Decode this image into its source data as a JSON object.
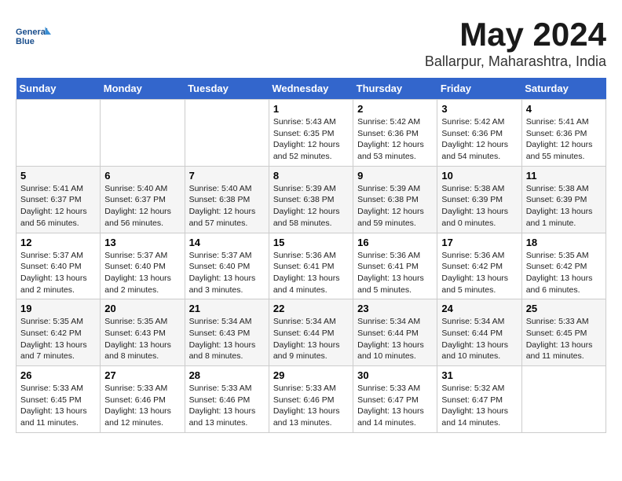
{
  "logo": {
    "line1": "General",
    "line2": "Blue"
  },
  "title": "May 2024",
  "subtitle": "Ballarpur, Maharashtra, India",
  "days_of_week": [
    "Sunday",
    "Monday",
    "Tuesday",
    "Wednesday",
    "Thursday",
    "Friday",
    "Saturday"
  ],
  "weeks": [
    [
      {
        "day": "",
        "info": ""
      },
      {
        "day": "",
        "info": ""
      },
      {
        "day": "",
        "info": ""
      },
      {
        "day": "1",
        "info": "Sunrise: 5:43 AM\nSunset: 6:35 PM\nDaylight: 12 hours\nand 52 minutes."
      },
      {
        "day": "2",
        "info": "Sunrise: 5:42 AM\nSunset: 6:36 PM\nDaylight: 12 hours\nand 53 minutes."
      },
      {
        "day": "3",
        "info": "Sunrise: 5:42 AM\nSunset: 6:36 PM\nDaylight: 12 hours\nand 54 minutes."
      },
      {
        "day": "4",
        "info": "Sunrise: 5:41 AM\nSunset: 6:36 PM\nDaylight: 12 hours\nand 55 minutes."
      }
    ],
    [
      {
        "day": "5",
        "info": "Sunrise: 5:41 AM\nSunset: 6:37 PM\nDaylight: 12 hours\nand 56 minutes."
      },
      {
        "day": "6",
        "info": "Sunrise: 5:40 AM\nSunset: 6:37 PM\nDaylight: 12 hours\nand 56 minutes."
      },
      {
        "day": "7",
        "info": "Sunrise: 5:40 AM\nSunset: 6:38 PM\nDaylight: 12 hours\nand 57 minutes."
      },
      {
        "day": "8",
        "info": "Sunrise: 5:39 AM\nSunset: 6:38 PM\nDaylight: 12 hours\nand 58 minutes."
      },
      {
        "day": "9",
        "info": "Sunrise: 5:39 AM\nSunset: 6:38 PM\nDaylight: 12 hours\nand 59 minutes."
      },
      {
        "day": "10",
        "info": "Sunrise: 5:38 AM\nSunset: 6:39 PM\nDaylight: 13 hours\nand 0 minutes."
      },
      {
        "day": "11",
        "info": "Sunrise: 5:38 AM\nSunset: 6:39 PM\nDaylight: 13 hours\nand 1 minute."
      }
    ],
    [
      {
        "day": "12",
        "info": "Sunrise: 5:37 AM\nSunset: 6:40 PM\nDaylight: 13 hours\nand 2 minutes."
      },
      {
        "day": "13",
        "info": "Sunrise: 5:37 AM\nSunset: 6:40 PM\nDaylight: 13 hours\nand 2 minutes."
      },
      {
        "day": "14",
        "info": "Sunrise: 5:37 AM\nSunset: 6:40 PM\nDaylight: 13 hours\nand 3 minutes."
      },
      {
        "day": "15",
        "info": "Sunrise: 5:36 AM\nSunset: 6:41 PM\nDaylight: 13 hours\nand 4 minutes."
      },
      {
        "day": "16",
        "info": "Sunrise: 5:36 AM\nSunset: 6:41 PM\nDaylight: 13 hours\nand 5 minutes."
      },
      {
        "day": "17",
        "info": "Sunrise: 5:36 AM\nSunset: 6:42 PM\nDaylight: 13 hours\nand 5 minutes."
      },
      {
        "day": "18",
        "info": "Sunrise: 5:35 AM\nSunset: 6:42 PM\nDaylight: 13 hours\nand 6 minutes."
      }
    ],
    [
      {
        "day": "19",
        "info": "Sunrise: 5:35 AM\nSunset: 6:42 PM\nDaylight: 13 hours\nand 7 minutes."
      },
      {
        "day": "20",
        "info": "Sunrise: 5:35 AM\nSunset: 6:43 PM\nDaylight: 13 hours\nand 8 minutes."
      },
      {
        "day": "21",
        "info": "Sunrise: 5:34 AM\nSunset: 6:43 PM\nDaylight: 13 hours\nand 8 minutes."
      },
      {
        "day": "22",
        "info": "Sunrise: 5:34 AM\nSunset: 6:44 PM\nDaylight: 13 hours\nand 9 minutes."
      },
      {
        "day": "23",
        "info": "Sunrise: 5:34 AM\nSunset: 6:44 PM\nDaylight: 13 hours\nand 10 minutes."
      },
      {
        "day": "24",
        "info": "Sunrise: 5:34 AM\nSunset: 6:44 PM\nDaylight: 13 hours\nand 10 minutes."
      },
      {
        "day": "25",
        "info": "Sunrise: 5:33 AM\nSunset: 6:45 PM\nDaylight: 13 hours\nand 11 minutes."
      }
    ],
    [
      {
        "day": "26",
        "info": "Sunrise: 5:33 AM\nSunset: 6:45 PM\nDaylight: 13 hours\nand 11 minutes."
      },
      {
        "day": "27",
        "info": "Sunrise: 5:33 AM\nSunset: 6:46 PM\nDaylight: 13 hours\nand 12 minutes."
      },
      {
        "day": "28",
        "info": "Sunrise: 5:33 AM\nSunset: 6:46 PM\nDaylight: 13 hours\nand 13 minutes."
      },
      {
        "day": "29",
        "info": "Sunrise: 5:33 AM\nSunset: 6:46 PM\nDaylight: 13 hours\nand 13 minutes."
      },
      {
        "day": "30",
        "info": "Sunrise: 5:33 AM\nSunset: 6:47 PM\nDaylight: 13 hours\nand 14 minutes."
      },
      {
        "day": "31",
        "info": "Sunrise: 5:32 AM\nSunset: 6:47 PM\nDaylight: 13 hours\nand 14 minutes."
      },
      {
        "day": "",
        "info": ""
      }
    ]
  ]
}
